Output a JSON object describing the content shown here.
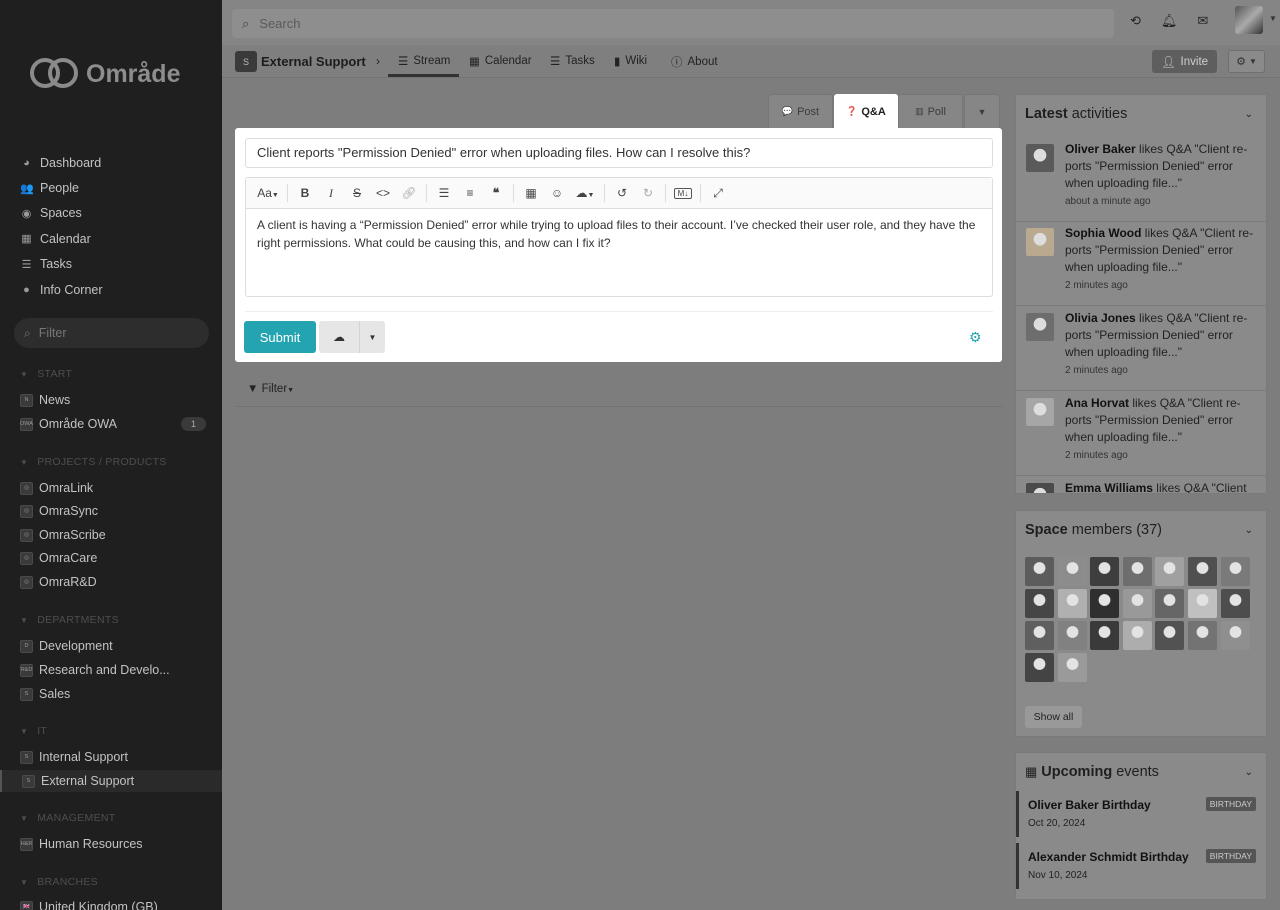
{
  "sidebar": {
    "logo_text": "Område",
    "nav": [
      {
        "label": "Dashboard",
        "icon": "dashboard-icon",
        "glyph": "◕"
      },
      {
        "label": "People",
        "icon": "people-icon",
        "glyph": "👥"
      },
      {
        "label": "Spaces",
        "icon": "spaces-icon",
        "glyph": "◉"
      },
      {
        "label": "Calendar",
        "icon": "calendar-icon",
        "glyph": "▦"
      },
      {
        "label": "Tasks",
        "icon": "tasks-icon",
        "glyph": "☰"
      },
      {
        "label": "Info Corner",
        "icon": "info-corner-icon",
        "glyph": "●"
      }
    ],
    "filter_placeholder": "Filter",
    "sections": [
      {
        "title": "START",
        "items": [
          {
            "label": "News",
            "chip": "N"
          },
          {
            "label": "Område OWA",
            "chip": "OWA",
            "count": "1"
          }
        ]
      },
      {
        "title": "PROJECTS / PRODUCTS",
        "items": [
          {
            "label": "OmraLink",
            "chip": "◎"
          },
          {
            "label": "OmraSync",
            "chip": "◎"
          },
          {
            "label": "OmraScribe",
            "chip": "◎"
          },
          {
            "label": "OmraCare",
            "chip": "◎"
          },
          {
            "label": "OmraR&D",
            "chip": "◎"
          }
        ]
      },
      {
        "title": "DEPARTMENTS",
        "items": [
          {
            "label": "Development",
            "chip": "D"
          },
          {
            "label": "Research and Develo...",
            "chip": "R&D"
          },
          {
            "label": "Sales",
            "chip": "S"
          }
        ]
      },
      {
        "title": "IT",
        "items": [
          {
            "label": "Internal Support",
            "chip": "S"
          },
          {
            "label": "External Support",
            "chip": "S",
            "active": true
          }
        ]
      },
      {
        "title": "MANAGEMENT",
        "items": [
          {
            "label": "Human Resources",
            "chip": "H&R"
          }
        ]
      },
      {
        "title": "BRANCHES",
        "items": [
          {
            "label": "United Kingdom (GB)",
            "chip": "🇬🇧"
          }
        ]
      }
    ]
  },
  "topbar": {
    "search_placeholder": "Search"
  },
  "subnav": {
    "space_chip": "S",
    "space_title": "External Support",
    "tabs": [
      {
        "label": "Stream",
        "glyph": "☰"
      },
      {
        "label": "Calendar",
        "glyph": "▦"
      },
      {
        "label": "Tasks",
        "glyph": "☰"
      },
      {
        "label": "Wiki",
        "glyph": "▮"
      },
      {
        "label": "About",
        "glyph": "ⓘ"
      }
    ],
    "invite_label": "Invite"
  },
  "composer": {
    "tabs": [
      {
        "label": "Post",
        "glyph": "💬"
      },
      {
        "label": "Q&A",
        "glyph": "❓"
      },
      {
        "label": "Poll",
        "glyph": "▥"
      }
    ],
    "title_value": "Client reports \"Permission Denied\" error when uploading files. How can I resolve this?",
    "body_value": "A client is having a “Permission Denied” error while trying to upload files to their account. I’ve checked their user role, and they have the right permissions. What could be causing this, and how can I fix it?",
    "toolbar": {
      "font_size": "Aa",
      "markdown": "M↓"
    },
    "submit_label": "Submit",
    "accent": "#24a3b0"
  },
  "stream": {
    "filter_label": "Filter"
  },
  "activities": {
    "title_bold": "Latest",
    "title_rest": "activities",
    "items": [
      {
        "name": "Oliver Baker",
        "text": " likes Q&A \"Client re-ports \"Permission Denied\" error when uploading file...\"",
        "time": "about a minute ago"
      },
      {
        "name": "Sophia Wood",
        "text": " likes Q&A \"Client re-ports \"Permission Denied\" error when uploading file...\"",
        "time": "2 minutes ago"
      },
      {
        "name": "Olivia Jones",
        "text": " likes Q&A \"Client re-ports \"Permission Denied\" error when uploading file...\"",
        "time": "2 minutes ago"
      },
      {
        "name": "Ana Horvat",
        "text": " likes Q&A \"Client re-ports \"Permission Denied\" error when uploading file...\"",
        "time": "2 minutes ago"
      },
      {
        "name": "Emma Williams",
        "text": " likes Q&A \"Client",
        "time": ""
      }
    ]
  },
  "members": {
    "title_bold": "Space",
    "title_rest": "members (37)",
    "count_shown": 23,
    "show_all_label": "Show all"
  },
  "events": {
    "title_bold": "Upcoming",
    "title_rest": "events",
    "items": [
      {
        "title": "Oliver Baker Birthday",
        "date": "Oct 20, 2024",
        "badge": "BIRTHDAY"
      },
      {
        "title": "Alexander Schmidt Birthday",
        "date": "Nov 10, 2024",
        "badge": "BIRTHDAY"
      }
    ]
  }
}
